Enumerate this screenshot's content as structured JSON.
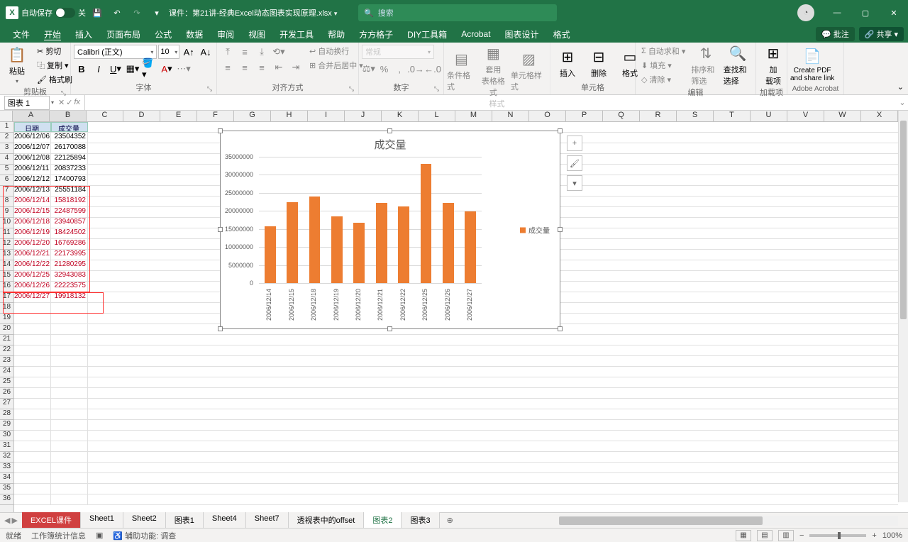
{
  "titlebar": {
    "autosave_label": "自动保存",
    "autosave_state": "关",
    "filename": "课件：第21讲-经典Excel动态图表实现原理.xlsx",
    "search_placeholder": "搜索"
  },
  "tabs": {
    "file": "文件",
    "home": "开始",
    "insert": "插入",
    "pagelayout": "页面布局",
    "formulas": "公式",
    "data": "数据",
    "review": "审阅",
    "view": "视图",
    "developer": "开发工具",
    "help": "帮助",
    "fanggezi": "方方格子",
    "diy": "DIY工具箱",
    "acrobat": "Acrobat",
    "chartdesign": "图表设计",
    "format": "格式",
    "comments": "批注",
    "share": "共享"
  },
  "ribbon": {
    "clipboard": {
      "label": "剪贴板",
      "paste": "粘贴",
      "cut": "剪切",
      "copy": "复制",
      "painter": "格式刷"
    },
    "font": {
      "label": "字体",
      "name": "Calibri (正文)",
      "size": "10"
    },
    "align": {
      "label": "对齐方式",
      "wrap": "自动换行",
      "merge": "合并后居中"
    },
    "number": {
      "label": "数字",
      "format": "常规"
    },
    "styles": {
      "label": "样式",
      "condfmt": "条件格式",
      "table": "套用\n表格格式",
      "cellstyle": "单元格样式"
    },
    "cells": {
      "label": "单元格",
      "insert": "插入",
      "delete": "删除",
      "format": "格式"
    },
    "editing": {
      "label": "编辑",
      "autosum": "自动求和",
      "fill": "填充",
      "clear": "清除",
      "sort": "排序和筛选",
      "find": "查找和选择"
    },
    "addins": {
      "label": "加载项",
      "addins": "加\n载项"
    },
    "acrobat": {
      "label": "Adobe Acrobat",
      "pdf": "Create PDF\nand share link"
    }
  },
  "namebox": "图表 1",
  "columns": [
    "A",
    "B",
    "C",
    "D",
    "E",
    "F",
    "G",
    "H",
    "I",
    "J",
    "K",
    "L",
    "M",
    "N",
    "O",
    "P",
    "Q",
    "R",
    "S",
    "T",
    "U",
    "V",
    "W",
    "X"
  ],
  "headers": {
    "date": "日期",
    "volume": "成交量"
  },
  "table": [
    {
      "date": "2006/12/06",
      "vol": 23504352
    },
    {
      "date": "2006/12/07",
      "vol": 26170088
    },
    {
      "date": "2006/12/08",
      "vol": 22125894
    },
    {
      "date": "2006/12/11",
      "vol": 20837233
    },
    {
      "date": "2006/12/12",
      "vol": 17400793
    },
    {
      "date": "2006/12/13",
      "vol": 25551184
    },
    {
      "date": "2006/12/14",
      "vol": 15818192
    },
    {
      "date": "2006/12/15",
      "vol": 22487599
    },
    {
      "date": "2006/12/18",
      "vol": 23940857
    },
    {
      "date": "2006/12/19",
      "vol": 18424502
    },
    {
      "date": "2006/12/20",
      "vol": 16769286
    },
    {
      "date": "2006/12/21",
      "vol": 22173995
    },
    {
      "date": "2006/12/22",
      "vol": 21280295
    },
    {
      "date": "2006/12/25",
      "vol": 32943083
    },
    {
      "date": "2006/12/26",
      "vol": 22223575
    },
    {
      "date": "2006/12/27",
      "vol": 19918132
    }
  ],
  "chart_data": {
    "type": "bar",
    "title": "成交量",
    "legend": "成交量",
    "ylim": [
      0,
      35000000
    ],
    "ystep": 5000000,
    "categories": [
      "2006/12/14",
      "2006/12/15",
      "2006/12/18",
      "2006/12/19",
      "2006/12/20",
      "2006/12/21",
      "2006/12/22",
      "2006/12/25",
      "2006/12/26",
      "2006/12/27"
    ],
    "values": [
      15818192,
      22487599,
      23940857,
      18424502,
      16769286,
      22173995,
      21280295,
      32943083,
      22223575,
      19918132
    ]
  },
  "sheets": {
    "items": [
      "EXCEL课件",
      "Sheet1",
      "Sheet2",
      "图表1",
      "Sheet4",
      "Sheet7",
      "透视表中的offset",
      "图表2",
      "图表3"
    ],
    "active": "图表2",
    "special": "EXCEL课件"
  },
  "status": {
    "ready": "就绪",
    "wbstats": "工作簿统计信息",
    "acc": "辅助功能: 调查",
    "zoom": "100%"
  }
}
